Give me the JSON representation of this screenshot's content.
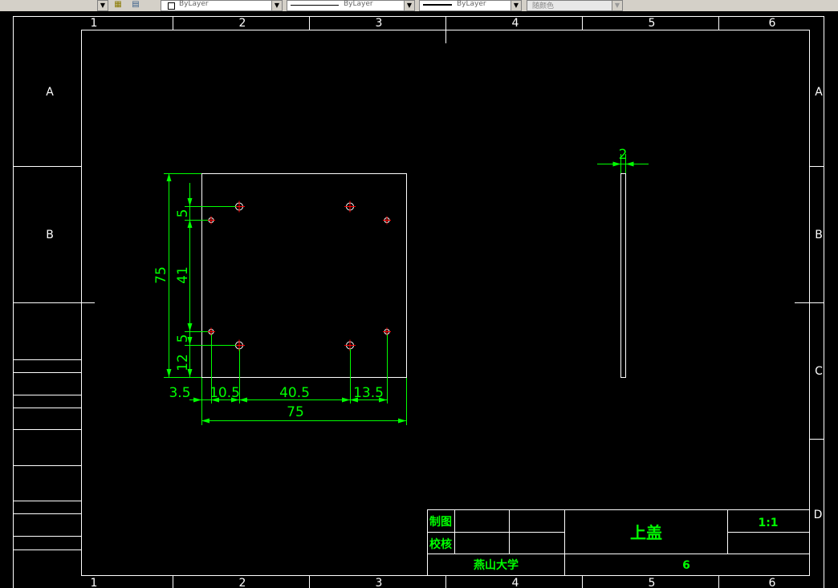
{
  "toolbar": {
    "layer_color": "ByLayer",
    "linetype": "ByLayer",
    "lineweight": "ByLayer",
    "plotstyle": "随颜色",
    "layer_icon": "layers-icon",
    "layer_states_icon": "layer-states-icon"
  },
  "colors": {
    "background": "#000000",
    "frame": "#ffffff",
    "dimension": "#00ff00",
    "center_mark": "#ff0000"
  },
  "frame": {
    "columns": [
      "1",
      "2",
      "3",
      "4",
      "5",
      "6"
    ],
    "rows": [
      "A",
      "B",
      "C",
      "D"
    ]
  },
  "drawing": {
    "dim_height": "75",
    "dim_inner_height": "41",
    "dim_top_offset": "5",
    "dim_bottom_offset": "5",
    "dim_bottom_margin": "12",
    "dim_x1": "3.5",
    "dim_x2": "10.5",
    "dim_x3": "40.5",
    "dim_x4": "13.5",
    "dim_width": "75",
    "dim_thickness": "2"
  },
  "title_block": {
    "drawn_label": "制图",
    "checked_label": "校核",
    "part_name": "上盖",
    "scale": "1:1",
    "school": "燕山大学",
    "sheet_no": "6"
  }
}
